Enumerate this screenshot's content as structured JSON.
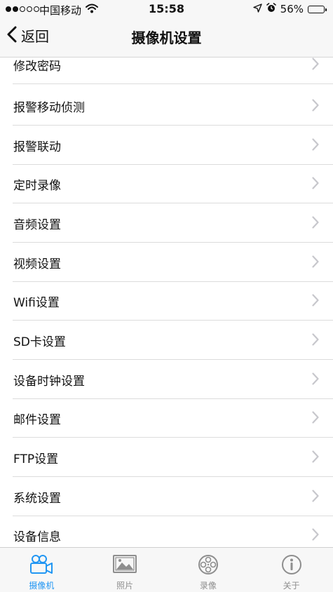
{
  "status": {
    "carrier": "中国移动",
    "time": "15:58",
    "battery": "56%",
    "battery_level": 0.56,
    "signal_bars_filled": 2,
    "signal_bars_total": 5
  },
  "nav": {
    "back_label": "返回",
    "title": "摄像机设置"
  },
  "items": [
    {
      "label": "修改密码"
    },
    {
      "label": "报警移动侦测"
    },
    {
      "label": "报警联动"
    },
    {
      "label": "定时录像"
    },
    {
      "label": "音频设置"
    },
    {
      "label": "视频设置"
    },
    {
      "label": "Wifi设置"
    },
    {
      "label": "SD卡设置"
    },
    {
      "label": "设备时钟设置"
    },
    {
      "label": "邮件设置"
    },
    {
      "label": "FTP设置"
    },
    {
      "label": "系统设置"
    },
    {
      "label": "设备信息"
    }
  ],
  "tabs": [
    {
      "label": "摄像机",
      "icon": "camera-icon",
      "active": true
    },
    {
      "label": "照片",
      "icon": "photo-icon",
      "active": false
    },
    {
      "label": "录像",
      "icon": "film-reel-icon",
      "active": false
    },
    {
      "label": "关于",
      "icon": "info-icon",
      "active": false
    }
  ],
  "colors": {
    "accent": "#2196f3",
    "inactive_tab": "#8e8e8e",
    "chevron": "#c7c7cc",
    "separator": "#dcdcdc",
    "bar_background": "#f7f7f7"
  }
}
